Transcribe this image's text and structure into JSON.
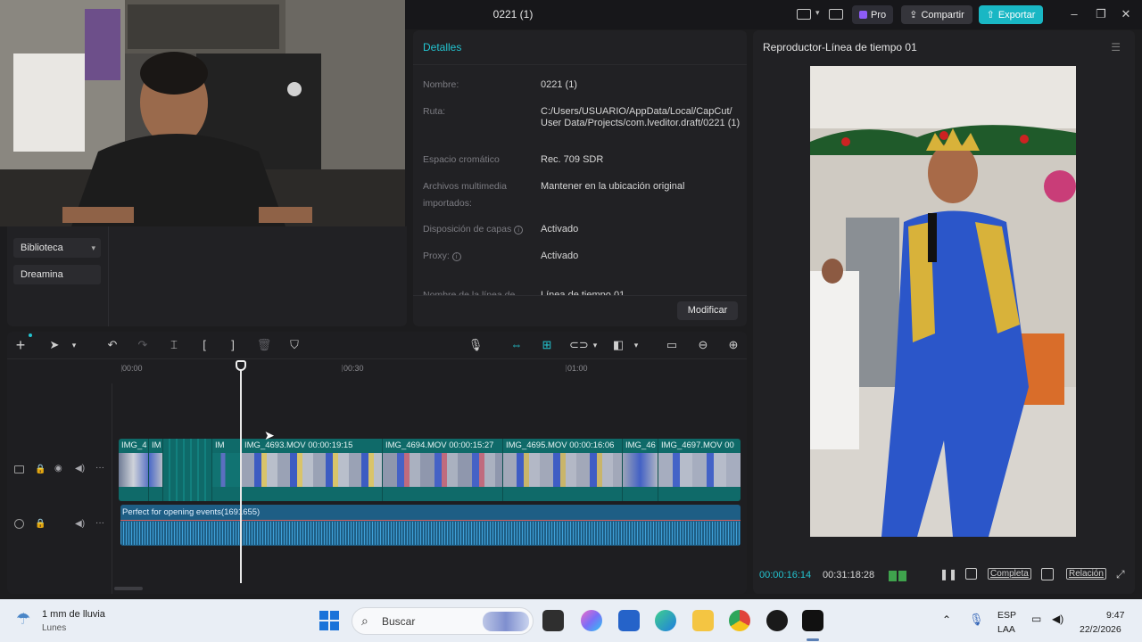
{
  "titlebar": {
    "project_title": "0221 (1)",
    "pro_label": "Pro",
    "share_label": "Compartir",
    "export_label": "Exportar"
  },
  "sidebar": {
    "items": [
      {
        "label": "Biblioteca"
      },
      {
        "label": "Dreamina"
      }
    ]
  },
  "details": {
    "title": "Detalles",
    "fields": [
      {
        "label": "Nombre:",
        "value": "0221 (1)"
      },
      {
        "label": "Ruta:",
        "value": "C:/Users/USUARIO/AppData/Local/CapCut/ User Data/Projects/com.lveditor.draft/0221 (1)"
      },
      {
        "label": "Espacio cromático",
        "value": "Rec. 709 SDR"
      },
      {
        "label": "Archivos multimedia importados:",
        "value": "Mantener en la ubicación original"
      },
      {
        "label": "Disposición de capas",
        "value": "Activado"
      },
      {
        "label": "Proxy:",
        "value": "Activado"
      },
      {
        "label": "Nombre de la línea de",
        "value": "Línea de tiempo 01"
      }
    ],
    "modify_label": "Modificar"
  },
  "player": {
    "title": "Reproductor-Línea de tiempo 01",
    "time_current": "00:00:16:14",
    "time_total": "00:31:18:28",
    "complete_label": "Completa",
    "ratio_label": "Relación"
  },
  "timeline": {
    "ruler": [
      "00:00",
      "00:30",
      "01:00"
    ],
    "clips": [
      {
        "label": "IMG_4"
      },
      {
        "label": "IM"
      },
      {
        "label": "IM"
      },
      {
        "label": "IMG_4693.MOV  00:00:19:15"
      },
      {
        "label": "IMG_4694.MOV  00:00:15:27"
      },
      {
        "label": "IMG_4695.MOV  00:00:16:06"
      },
      {
        "label": "IMG_46"
      },
      {
        "label": "IMG_4697.MOV  00"
      }
    ],
    "audio_label": "Perfect for opening events(1691655)"
  },
  "taskbar": {
    "weather": "1 mm de lluvia",
    "weather_sub": "Lunes",
    "search_placeholder": "Buscar",
    "lang_top": "ESP",
    "lang_bottom": "LAA",
    "time": "9:47",
    "date": "22/2/2026"
  },
  "colors": {
    "accent": "#23c4d0",
    "export": "#19b7c4",
    "video_track": "#0f6a69",
    "audio_track": "#1e5e85"
  }
}
